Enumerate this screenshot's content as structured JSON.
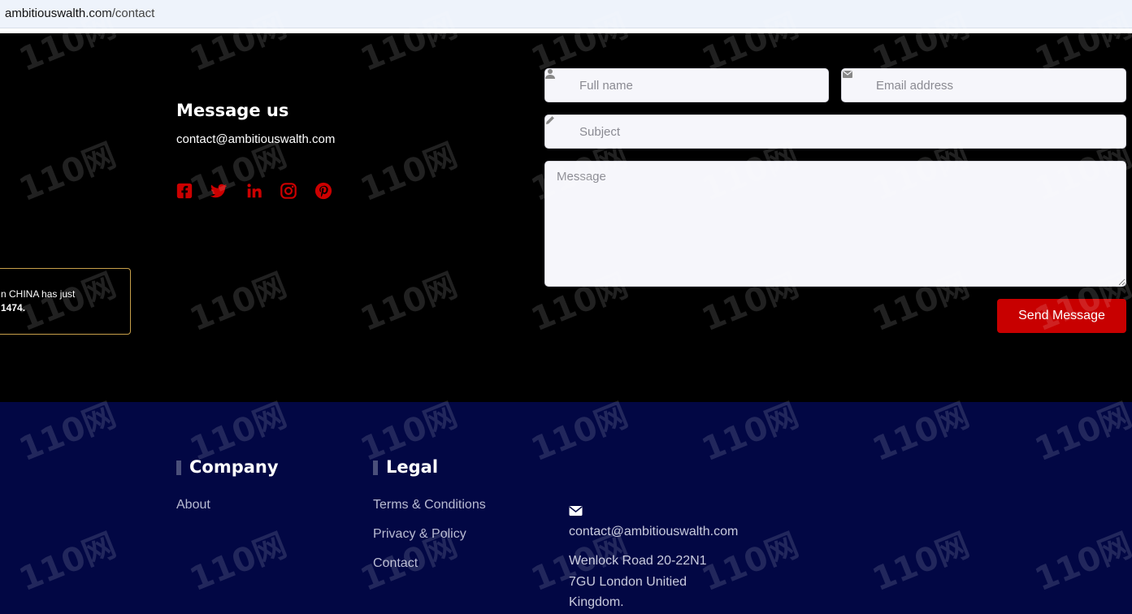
{
  "browser": {
    "url_host": "ambitiouswalth.com",
    "url_path": "/contact"
  },
  "contact": {
    "title": "Message us",
    "email": "contact@ambitiouswalth.com",
    "social_icons": [
      "facebook-icon",
      "twitter-icon",
      "linkedin-icon",
      "instagram-icon",
      "pinterest-icon"
    ],
    "accent_color": "#cc0000"
  },
  "popup": {
    "line1": "n CHINA has just",
    "line2": "1474."
  },
  "form": {
    "full_name_placeholder": "Full name",
    "email_placeholder": "Email address",
    "subject_placeholder": "Subject",
    "message_placeholder": "Message",
    "send_label": "Send Message",
    "button_color": "#c80000"
  },
  "footer": {
    "company_title": "Company",
    "company_links": [
      "About"
    ],
    "legal_title": "Legal",
    "legal_links": [
      "Terms & Conditions",
      "Privacy & Policy",
      "Contact"
    ],
    "contact_email": "contact@ambitiouswalth.com",
    "address_lines": [
      "Wenlock Road 20-22N1",
      "7GU London Unitied",
      "Kingdom."
    ],
    "background_color": "#020744"
  },
  "watermark": {
    "text": "110网"
  }
}
